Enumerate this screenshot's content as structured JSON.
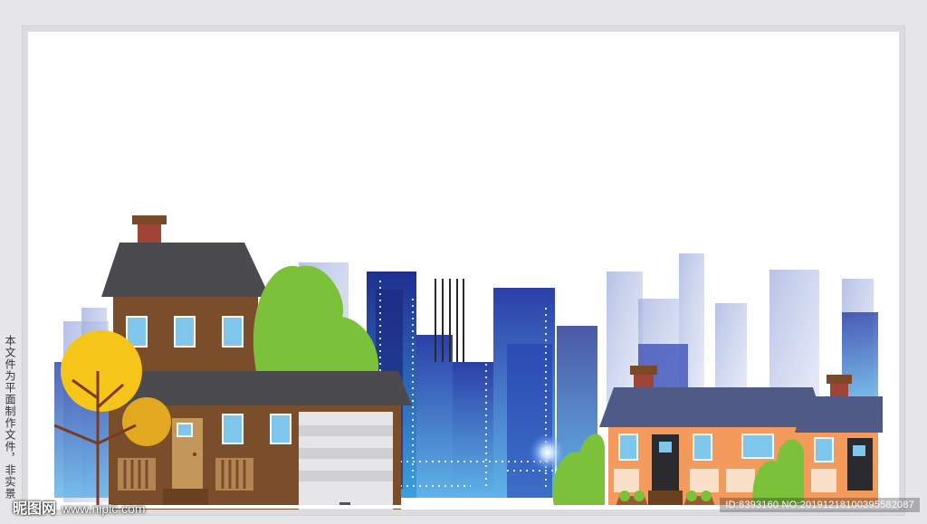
{
  "side_notice": "本文件为平面制作文件，非实景",
  "watermark": {
    "brand": "昵图网",
    "url": "www.nipic.com"
  },
  "image_id": "ID:8393160 NO:20191218100395582087"
}
